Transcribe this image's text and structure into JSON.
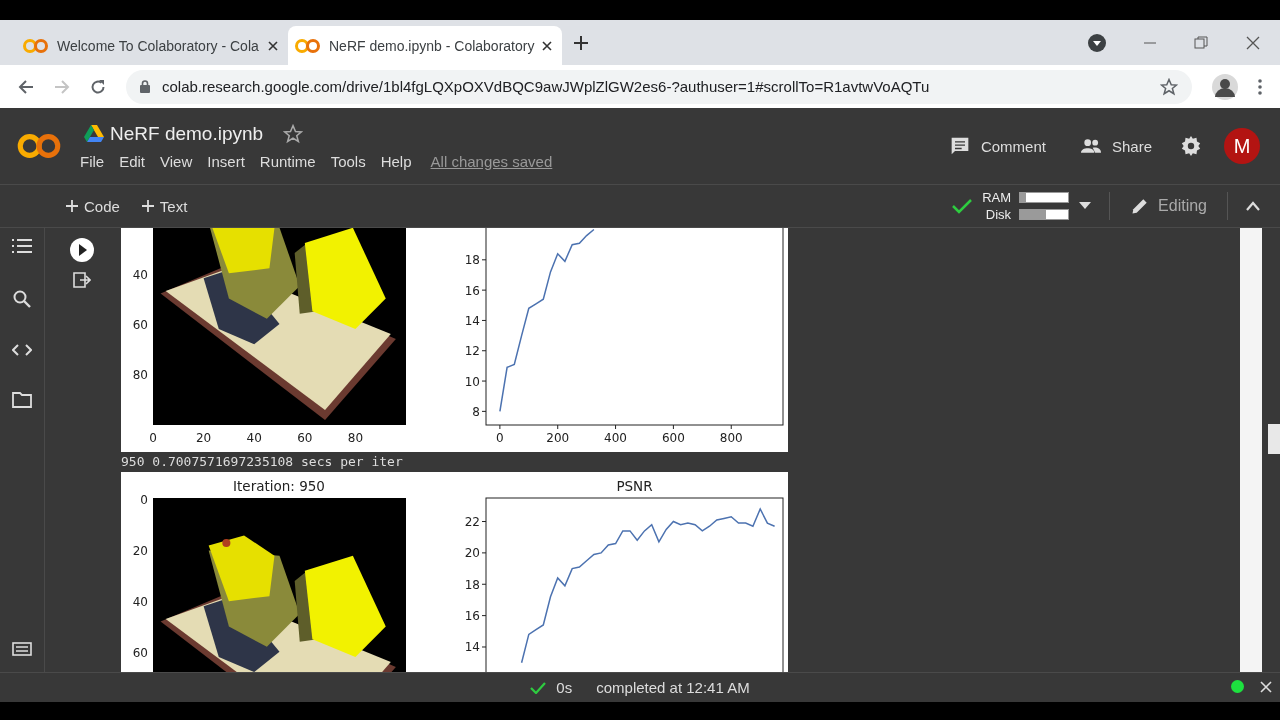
{
  "browser": {
    "tabs": [
      {
        "title": "Welcome To Colaboratory - Cola",
        "selected": false
      },
      {
        "title": "NeRF demo.ipynb - Colaboratory",
        "selected": true
      }
    ],
    "forward_disabled": true,
    "url": "colab.research.google.com/drive/1bl4fgLQXpOXVdBQC9awJWplZlGW2es6-?authuser=1#scrollTo=R1avtwVoAQTu"
  },
  "notebook": {
    "title": "NeRF demo.ipynb",
    "starred": false,
    "menu": [
      "File",
      "Edit",
      "View",
      "Insert",
      "Runtime",
      "Tools",
      "Help"
    ],
    "save_status": "All changes saved",
    "actions": [
      "Comment",
      "Share"
    ],
    "avatar": "M"
  },
  "toolbar": {
    "add": [
      "Code",
      "Text"
    ],
    "connected": true,
    "meters": [
      {
        "label": "RAM",
        "level": 0.12
      },
      {
        "label": "Disk",
        "level": 0.55
      }
    ],
    "mode": "Editing"
  },
  "output": [
    {
      "kind": "figure",
      "image_yticks": [
        "40",
        "60",
        "80"
      ],
      "image_xticks": [
        "0",
        "20",
        "40",
        "60",
        "80"
      ],
      "chart_data": {
        "type": "line",
        "x": [
          0,
          25,
          50,
          75,
          100,
          125,
          150,
          175,
          200,
          225,
          250,
          275,
          300,
          325
        ],
        "series": [
          {
            "color": "#4c72b0",
            "values": [
              8.0,
              10.9,
              11.1,
              13.0,
              14.8,
              15.1,
              15.4,
              17.2,
              18.4,
              17.9,
              19.0,
              19.1,
              19.6,
              20.0
            ]
          }
        ],
        "xlim": [
          -48,
          979
        ],
        "ylim": [
          7.1,
          20.1
        ],
        "xticks": [
          0,
          200,
          400,
          600,
          800
        ],
        "yticks": [
          8,
          10,
          12,
          14,
          16,
          18
        ]
      }
    },
    {
      "kind": "text",
      "text": "950 0.7007571697235108 secs per iter"
    },
    {
      "kind": "figure",
      "image_title": "Iteration: 950",
      "image_yticks": [
        "0",
        "20",
        "40",
        "60"
      ],
      "chart_data": {
        "type": "line",
        "title": "PSNR",
        "x": [
          75,
          100,
          125,
          150,
          175,
          200,
          225,
          250,
          275,
          300,
          325,
          350,
          375,
          400,
          425,
          450,
          475,
          500,
          525,
          550,
          575,
          600,
          625,
          650,
          675,
          700,
          725,
          750,
          775,
          800,
          825,
          850,
          875,
          900,
          925,
          950
        ],
        "series": [
          {
            "color": "#4c72b0",
            "values": [
              13.0,
              14.8,
              15.1,
              15.4,
              17.2,
              18.4,
              17.9,
              19.0,
              19.1,
              19.5,
              19.9,
              20.0,
              20.5,
              20.6,
              21.4,
              21.4,
              20.8,
              21.4,
              21.8,
              20.7,
              21.5,
              22.0,
              21.8,
              21.9,
              21.8,
              21.4,
              21.7,
              22.1,
              22.2,
              22.3,
              21.9,
              21.9,
              21.7,
              22.8,
              21.9,
              21.7
            ]
          }
        ],
        "xlim": [
          -48,
          979
        ],
        "ylim": [
          12.15,
          23.5
        ],
        "yticks": [
          14,
          16,
          18,
          20,
          22
        ]
      }
    }
  ],
  "status": {
    "ok": true,
    "duration": "0s",
    "message": "completed at 12:41 AM",
    "connected": true
  }
}
